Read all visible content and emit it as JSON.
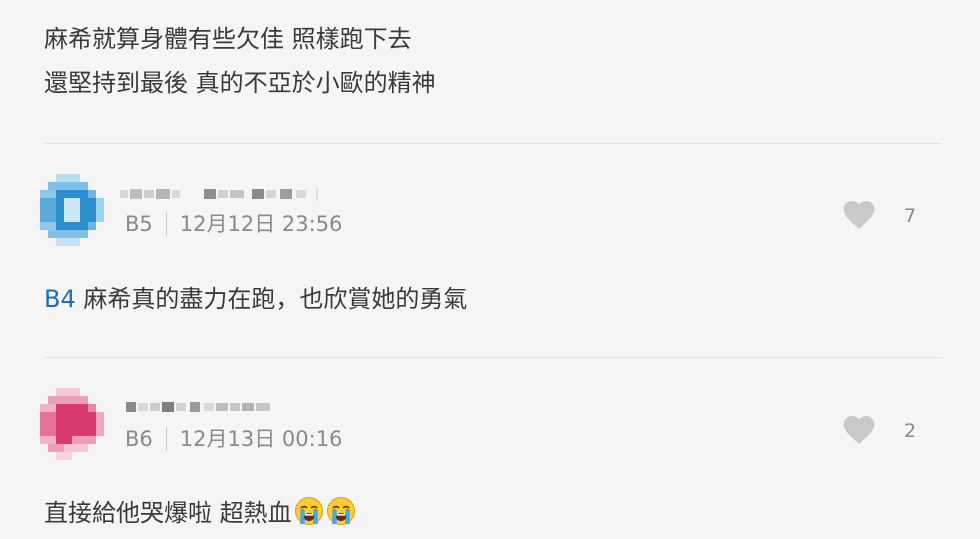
{
  "previous_comment": {
    "lines": [
      "麻希就算身體有些欠佳 照樣跑下去",
      "還堅持到最後 真的不亞於小歐的精神"
    ]
  },
  "comments": [
    {
      "floor": "B5",
      "timestamp": "12月12日 23:56",
      "like_count": "7",
      "reply_ref": "B4",
      "text": "麻希真的盡力在跑，也欣賞她的勇氣",
      "avatar_color": "#2b8fcf"
    },
    {
      "floor": "B6",
      "timestamp": "12月13日 00:16",
      "like_count": "2",
      "text": "直接給他哭爆啦 超熱血",
      "emojis": [
        "crying-face",
        "crying-face"
      ],
      "avatar_color": "#d93a6e"
    }
  ],
  "colors": {
    "link": "#1a6fb5",
    "muted": "#8a8a8a",
    "background": "#f5f5f5",
    "heart": "#c9c9c9"
  }
}
